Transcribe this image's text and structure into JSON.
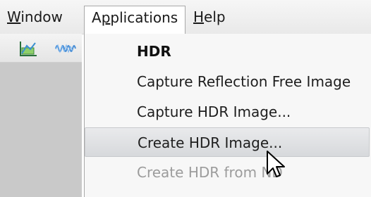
{
  "menubar": {
    "window_label": "Window",
    "applications_label": "Applications",
    "help_label": "Help"
  },
  "toolbar": {
    "icons": [
      "chart-icon",
      "waveform-icon"
    ]
  },
  "menu": {
    "header": "HDR",
    "items": [
      {
        "label": "Capture Reflection Free Image",
        "state": "normal"
      },
      {
        "label": "Capture HDR Image...",
        "state": "normal"
      },
      {
        "label": "Create HDR Image...",
        "state": "highlighted"
      },
      {
        "label": "Create HDR from ND",
        "state": "disabled"
      }
    ]
  },
  "colors": {
    "highlight": "#d7d9dc",
    "disabled_text": "#9c9c9c",
    "panel_background": "#c9c9c9"
  }
}
